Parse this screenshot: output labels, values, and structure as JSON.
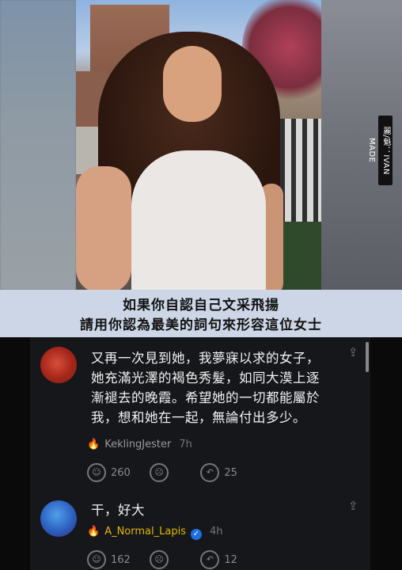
{
  "photo": {
    "watermark": "麗/魁：IVAN MADE"
  },
  "caption": {
    "line1": "如果你自認自己文采飛揚",
    "line2": "請用你認為最美的詞句來形容這位女士"
  },
  "comments": [
    {
      "text": "又再一次見到她，我夢寐以求的女子，\n她充滿光澤的褐色秀髮，如同大漠上逐\n漸褪去的晚霞。希望她的一切都能屬於\n我，想和她在一起，無論付出多少。",
      "username": "KeklingJester",
      "time": "7h",
      "likes": "260",
      "replies": "25",
      "verified": false
    },
    {
      "text": "干，好大",
      "username": "A_Normal_Lapis",
      "time": "4h",
      "likes": "162",
      "replies": "12",
      "verified": true
    }
  ],
  "icons": {
    "share": "share-icon",
    "flame": "flame-icon",
    "like": "smile-icon",
    "dislike": "frown-icon",
    "reply": "reply-icon",
    "verified": "verified-icon"
  },
  "colors": {
    "caption_bg": "#cdd6e6",
    "panel_bg": "#16171a",
    "flame": "#f0b21f",
    "verified": "#1d6fe0"
  }
}
